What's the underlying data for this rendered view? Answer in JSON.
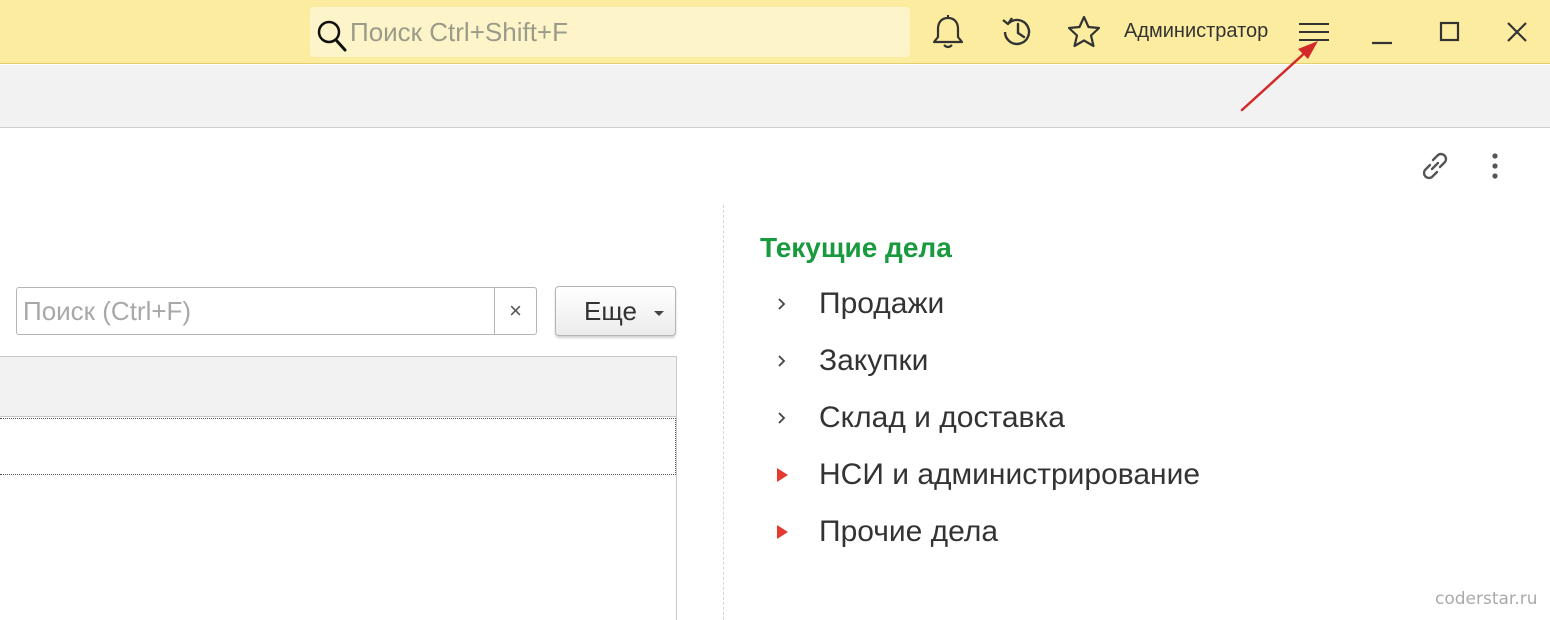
{
  "titlebar": {
    "search_placeholder": "Поиск Ctrl+Shift+F",
    "user_name": "Администратор"
  },
  "list": {
    "search_placeholder": "Поиск (Ctrl+F)",
    "clear_label": "×",
    "more_label": "Еще"
  },
  "tasks": {
    "title": "Текущие дела",
    "items": [
      {
        "label": "Продажи",
        "indicator": "chevron"
      },
      {
        "label": "Закупки",
        "indicator": "chevron"
      },
      {
        "label": "Склад и доставка",
        "indicator": "chevron"
      },
      {
        "label": "НСИ и администрирование",
        "indicator": "red-triangle"
      },
      {
        "label": "Прочие дела",
        "indicator": "red-triangle"
      }
    ]
  },
  "watermark": "coderstar.ru",
  "colors": {
    "titlebar_bg": "#fbec9f",
    "tasks_title": "#199a3f",
    "attention_indicator": "#e53a2f",
    "annotation_arrow": "#d22a2a"
  }
}
